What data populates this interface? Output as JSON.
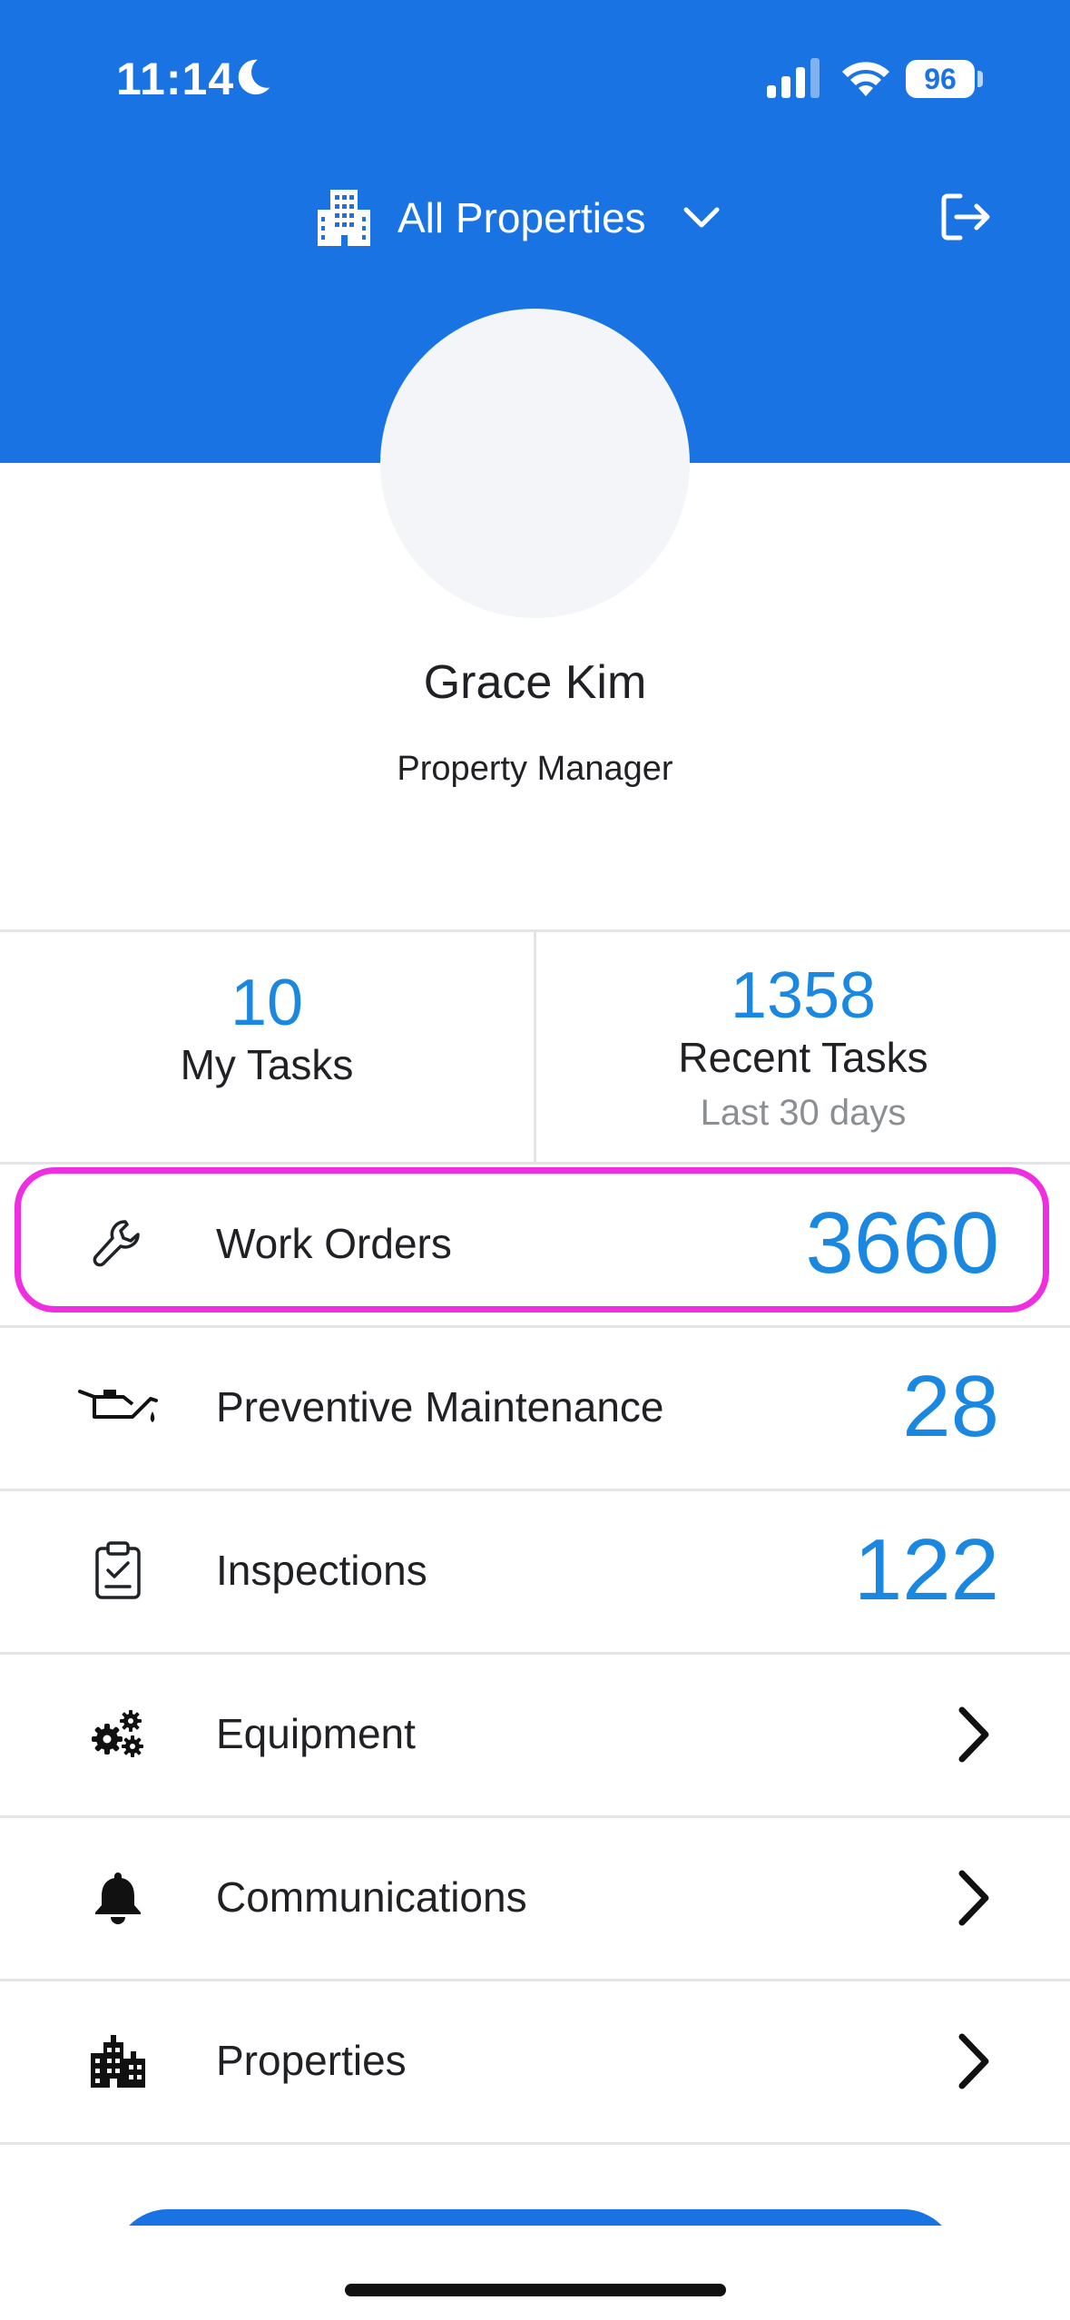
{
  "status_bar": {
    "time": "11:14",
    "battery": "96"
  },
  "header": {
    "property_selector": "All Properties"
  },
  "profile": {
    "name": "Grace Kim",
    "role": "Property Manager"
  },
  "stats": {
    "my_tasks": {
      "value": "10",
      "label": "My Tasks"
    },
    "recent_tasks": {
      "value": "1358",
      "label": "Recent Tasks",
      "sub": "Last 30 days"
    }
  },
  "menu": [
    {
      "label": "Work Orders",
      "count": "3660",
      "icon": "wrench-icon"
    },
    {
      "label": "Preventive Maintenance",
      "count": "28",
      "icon": "oil-can-icon"
    },
    {
      "label": "Inspections",
      "count": "122",
      "icon": "clipboard-check-icon"
    },
    {
      "label": "Equipment",
      "icon": "gears-icon"
    },
    {
      "label": "Communications",
      "icon": "bell-icon"
    },
    {
      "label": "Properties",
      "icon": "building-icon"
    }
  ],
  "colors": {
    "header": "#1a73e3",
    "accent": "#1a88e0",
    "highlight": "#f02ee1"
  }
}
